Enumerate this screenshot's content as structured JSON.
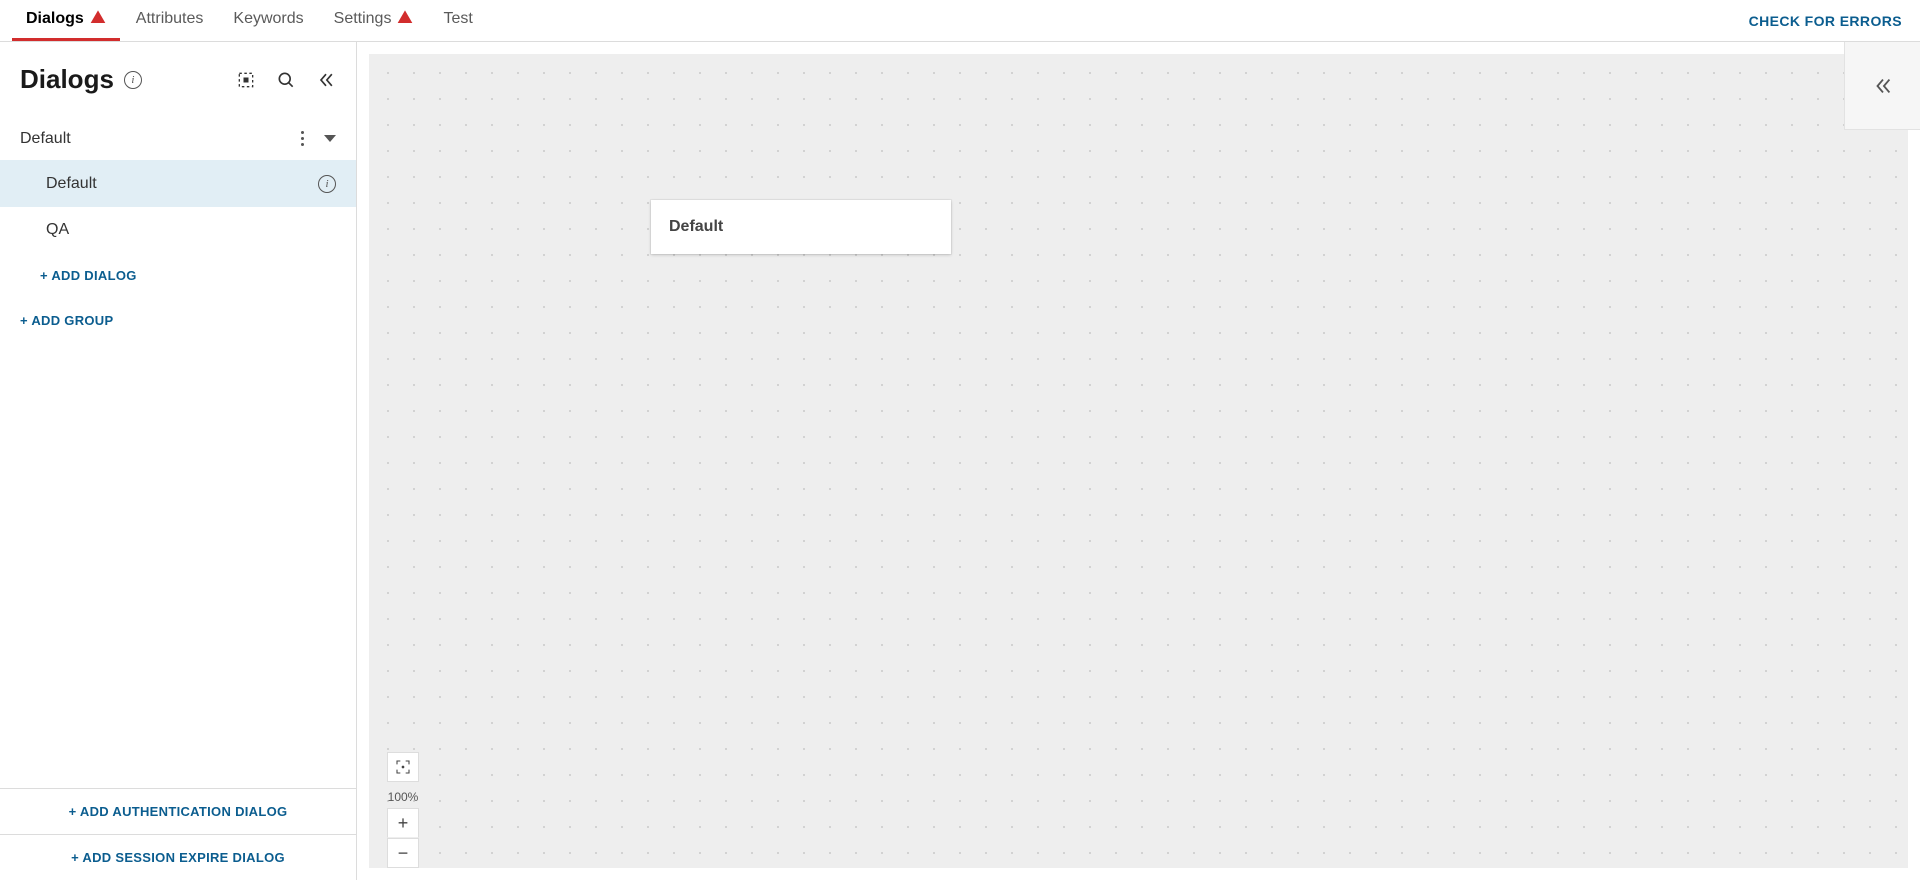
{
  "tabs": [
    {
      "label": "Dialogs",
      "warning": true,
      "active": true
    },
    {
      "label": "Attributes",
      "warning": false,
      "active": false
    },
    {
      "label": "Keywords",
      "warning": false,
      "active": false
    },
    {
      "label": "Settings",
      "warning": true,
      "active": false
    },
    {
      "label": "Test",
      "warning": false,
      "active": false
    }
  ],
  "check_errors_label": "CHECK FOR ERRORS",
  "sidebar": {
    "title": "Dialogs",
    "group": {
      "name": "Default"
    },
    "dialogs": [
      {
        "name": "Default",
        "selected": true,
        "info": true
      },
      {
        "name": "QA",
        "selected": false,
        "info": false
      }
    ],
    "add_dialog_label": "+ ADD DIALOG",
    "add_group_label": "+ ADD GROUP",
    "footer": {
      "add_auth_label": "+ ADD AUTHENTICATION DIALOG",
      "add_session_label": "+ ADD SESSION EXPIRE DIALOG"
    }
  },
  "canvas": {
    "node_title": "Default",
    "zoom_level": "100%"
  }
}
